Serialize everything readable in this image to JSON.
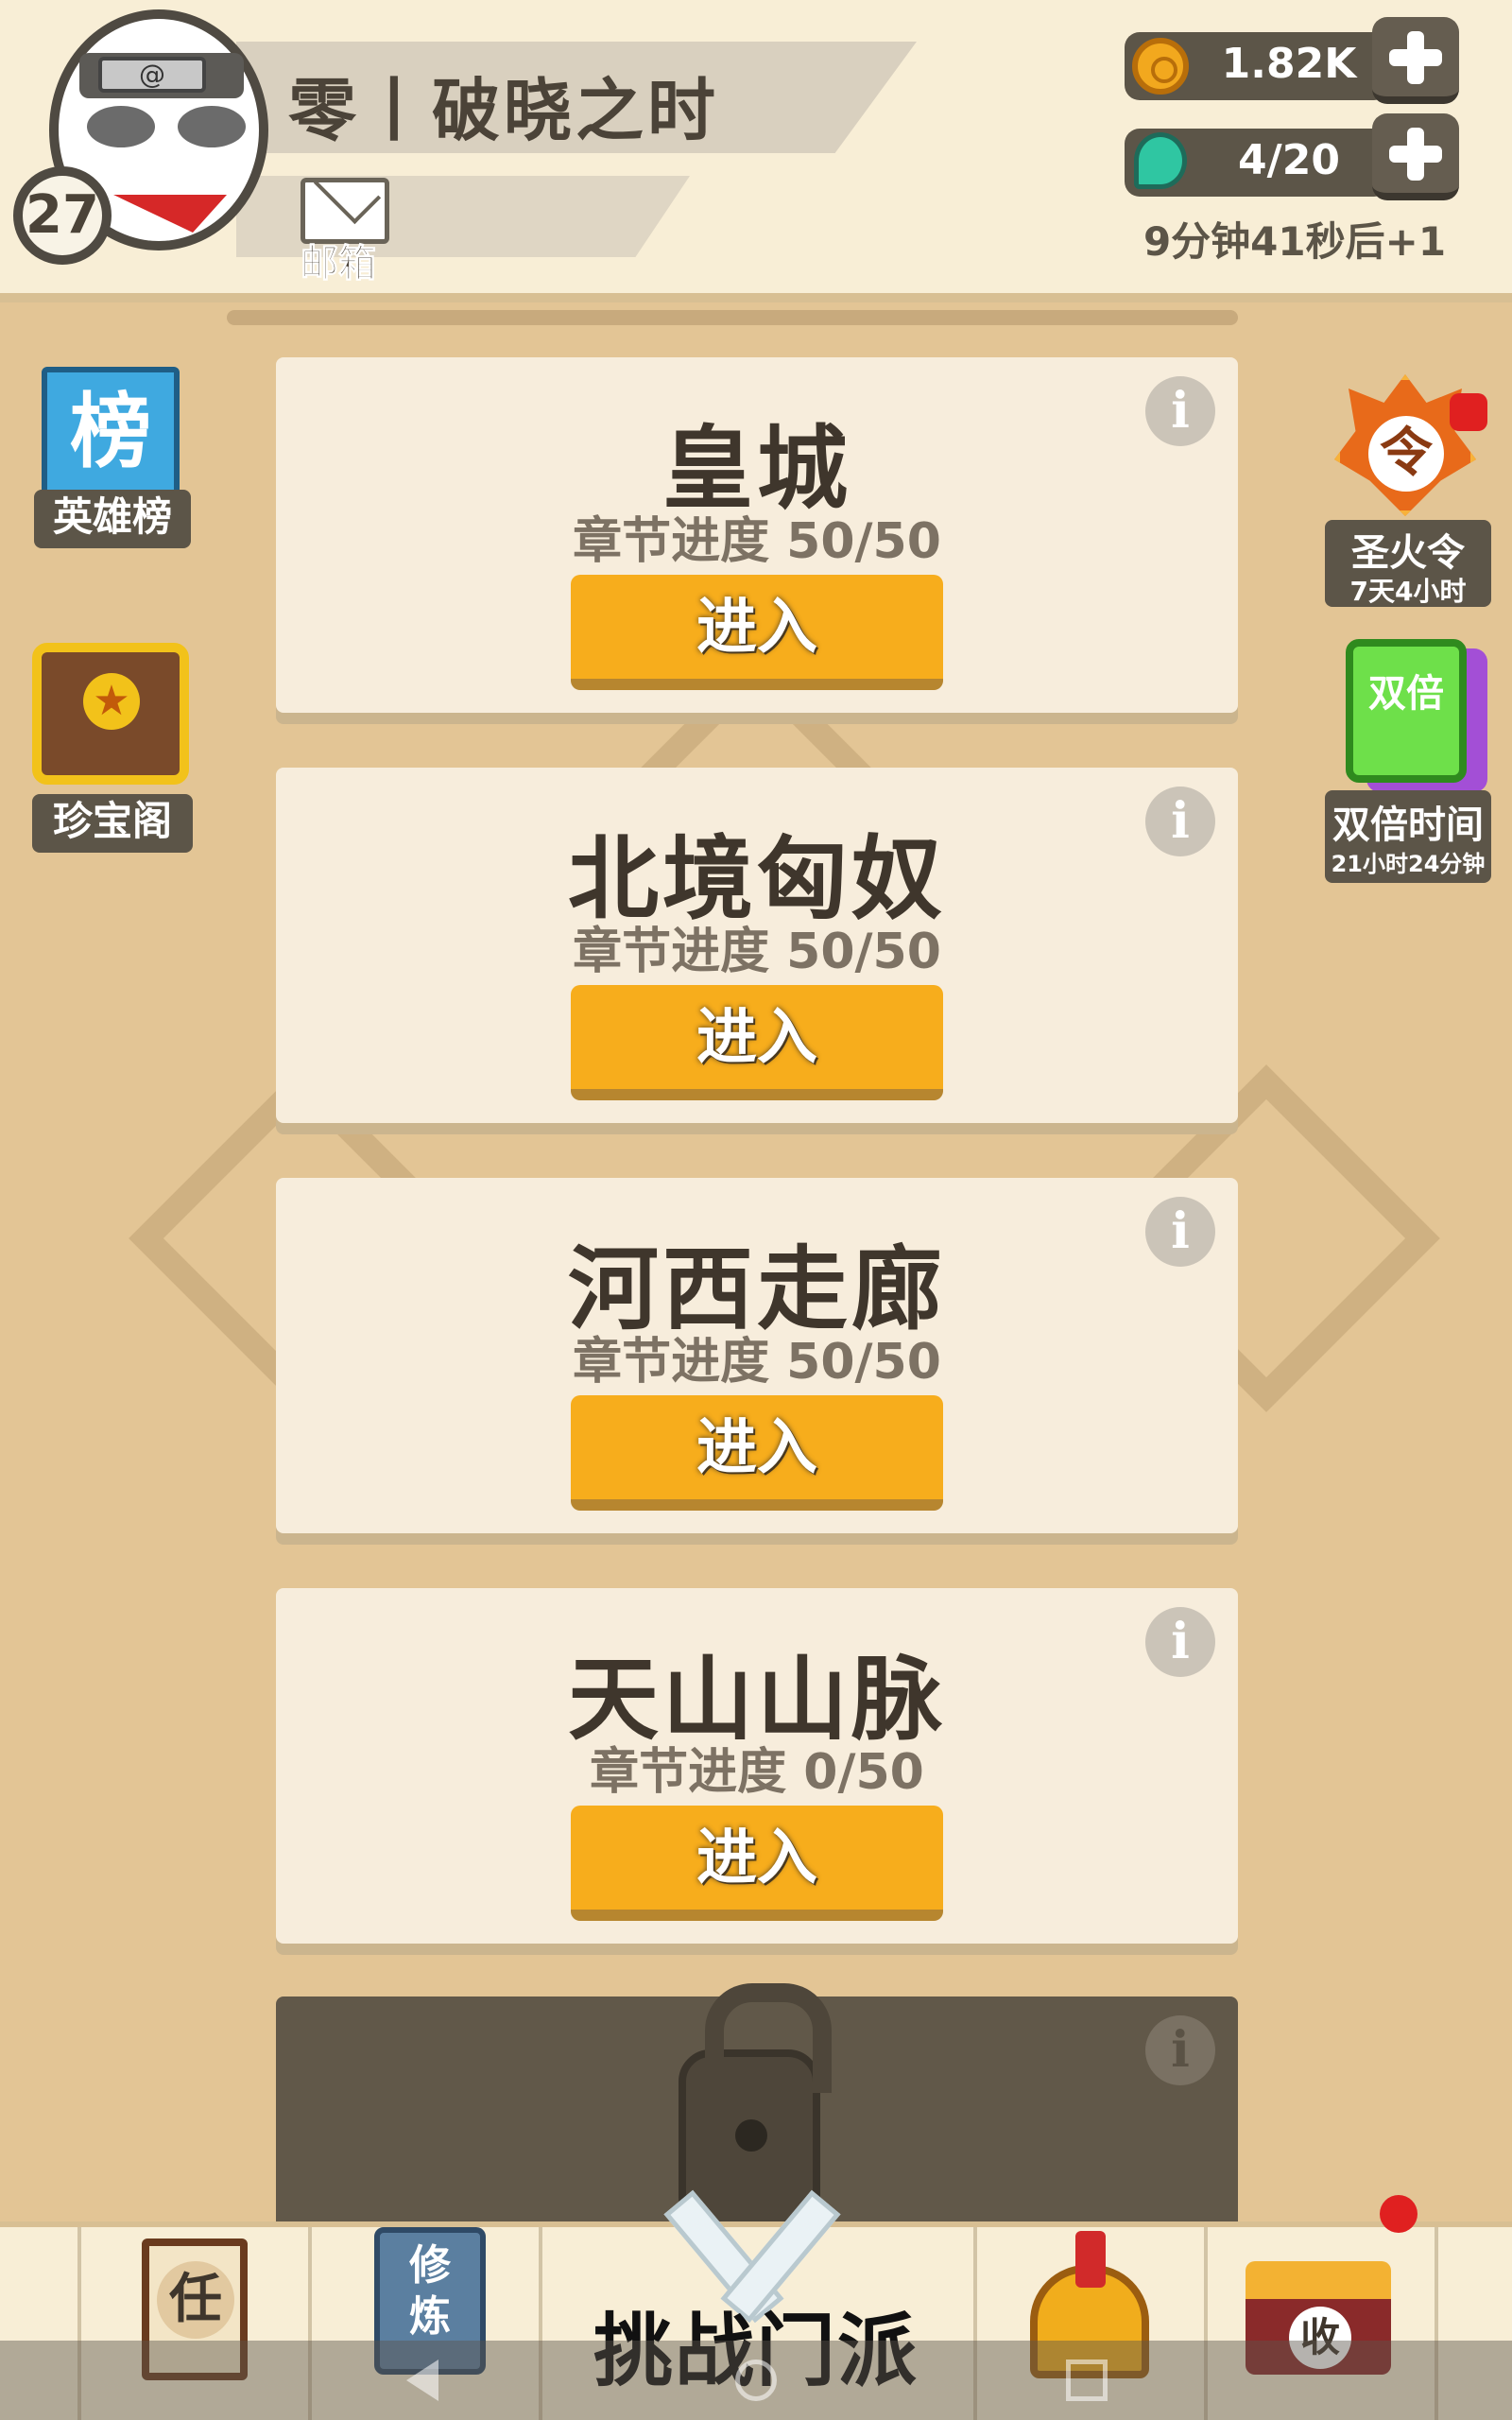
{
  "player": {
    "name": "零丨破晓之时",
    "level": "27",
    "mail_label": "邮箱",
    "headband_symbol": "@"
  },
  "resources": {
    "coins": "1.82K",
    "stamina": "4/20",
    "stamina_timer": "9分钟41秒后+1"
  },
  "side_left": {
    "hero_rank_icon_char": "榜",
    "hero_rank_label": "英雄榜",
    "treasure_label": "珍宝阁"
  },
  "side_right": {
    "fire_order_icon_char": "令",
    "fire_order_label": "圣火令",
    "fire_order_timer": "7天4小时",
    "double_card_text": "双倍",
    "double_time_label": "双倍时间",
    "double_time_timer": "21小时24分钟"
  },
  "levels": [
    {
      "title": "皇城",
      "progress": "章节进度 50/50",
      "enter": "进入"
    },
    {
      "title": "北境匈奴",
      "progress": "章节进度 50/50",
      "enter": "进入"
    },
    {
      "title": "河西走廊",
      "progress": "章节进度 50/50",
      "enter": "进入"
    },
    {
      "title": "天山山脉",
      "progress": "章节进度 0/50",
      "enter": "进入"
    }
  ],
  "info_glyph": "i",
  "bottom_nav": {
    "quest_char": "任",
    "cultivate_text": "修\n炼",
    "challenge_label": "挑战门派",
    "shop_char": "收"
  },
  "colors": {
    "background": "#e3c595",
    "header": "#f8eed6",
    "card": "#f7eddc",
    "button": "#f7ad1c",
    "dark_panel": "#5c5548"
  }
}
